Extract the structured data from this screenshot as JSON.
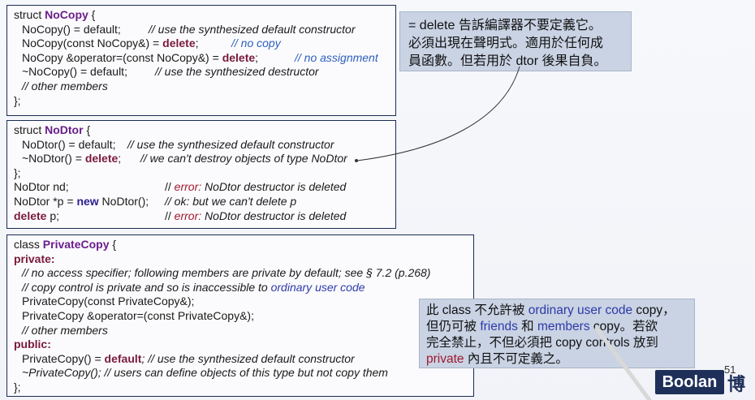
{
  "box1": {
    "l1": [
      "struct ",
      "NoCopy",
      " {"
    ],
    "l2": [
      "NoCopy() = default;",
      "// use the synthesized default constructor"
    ],
    "l3": [
      "NoCopy(const NoCopy&) = ",
      "delete",
      ";",
      "// no copy"
    ],
    "l4": [
      "NoCopy &operator=(const NoCopy&) = ",
      "delete",
      ";",
      "// no assignment"
    ],
    "l5": [
      "~NoCopy() = default;",
      "// use the synthesized destructor"
    ],
    "l6": "// other members",
    "l7": "};"
  },
  "box2": {
    "l1": [
      "struct ",
      "NoDtor",
      " {"
    ],
    "l2": [
      "NoDtor() = default;",
      "// use the synthesized default constructor"
    ],
    "l3": [
      "~NoDtor() = ",
      "delete",
      ";",
      "// we can't destroy objects of type NoDtor"
    ],
    "l4": "};",
    "l5": [
      "NoDtor nd;",
      "// ",
      "error:",
      " NoDtor destructor is deleted"
    ],
    "l6": [
      "NoDtor *p = ",
      "new",
      " NoDtor();",
      "// ok: but we can't delete p"
    ],
    "l7": [
      "delete",
      " p;",
      "// ",
      "error:",
      " NoDtor destructor is deleted"
    ]
  },
  "box3": {
    "l1": [
      "class ",
      "PrivateCopy",
      " {"
    ],
    "l2": "private:",
    "l3": "// no access specifier; following members are private by default; see § 7.2 (p.268)",
    "l4": [
      "// copy control is private and so is inaccessible to ",
      "ordinary user code"
    ],
    "l5": "PrivateCopy(const PrivateCopy&);",
    "l6": "PrivateCopy &operator=(const PrivateCopy&);",
    "l7": "// other members",
    "l8": "public:",
    "l9": [
      "PrivateCopy() = ",
      "default",
      "; // use the synthesized default constructor"
    ],
    "l10": "~PrivateCopy(); // users can define objects of this type but not copy them",
    "l11": "};"
  },
  "note1": {
    "line1": "= delete 告訴編譯器不要定義它。",
    "line2": "必須出現在聲明式。適用於任何成",
    "line3": "員函數。但若用於 dtor 後果自負。"
  },
  "note2": {
    "l1a": "此 class 不允許被 ",
    "l1b": "ordinary user code",
    "l1c": " copy，",
    "l2a": "但仍可被 ",
    "l2b": "friends",
    "l2c": " 和 ",
    "l2d": "members",
    "l2e": " copy。若欲",
    "l3": "完全禁止，不但必須把 copy controls 放到",
    "l4a": "private",
    "l4b": " 內且不可定義之。"
  },
  "footer": {
    "logo": "Boolan",
    "page": "51",
    "logo_cn": "博"
  }
}
